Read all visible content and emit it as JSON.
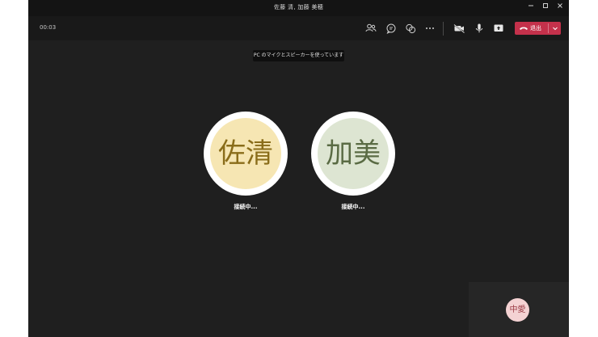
{
  "window": {
    "title": "佐藤 清, 加藤 美穂"
  },
  "controls": {
    "minimize_icon": "minimize-icon",
    "maximize_icon": "maximize-icon",
    "close_icon": "close-icon"
  },
  "toolbar": {
    "timer": "00:03",
    "icons": [
      "people-icon",
      "chat-icon",
      "share-reaction-icon",
      "more-icon",
      "camera-icon",
      "microphone-icon",
      "share-screen-icon"
    ],
    "hangup_label": "退出"
  },
  "notice": "PC のマイクとスピーカーを使っています",
  "participants": [
    {
      "initials": "佐清",
      "status": "接続中...",
      "bg": "#f6e6b3",
      "fg": "#8a6d1a"
    },
    {
      "initials": "加美",
      "status": "接続中...",
      "bg": "#dde5d2",
      "fg": "#5a6b44"
    }
  ],
  "self_view": {
    "initials": "中愛",
    "bg": "#f4d2d3",
    "fg": "#9b3c45"
  },
  "colors": {
    "hangup": "#c4314b",
    "background": "#1f1f1f"
  }
}
